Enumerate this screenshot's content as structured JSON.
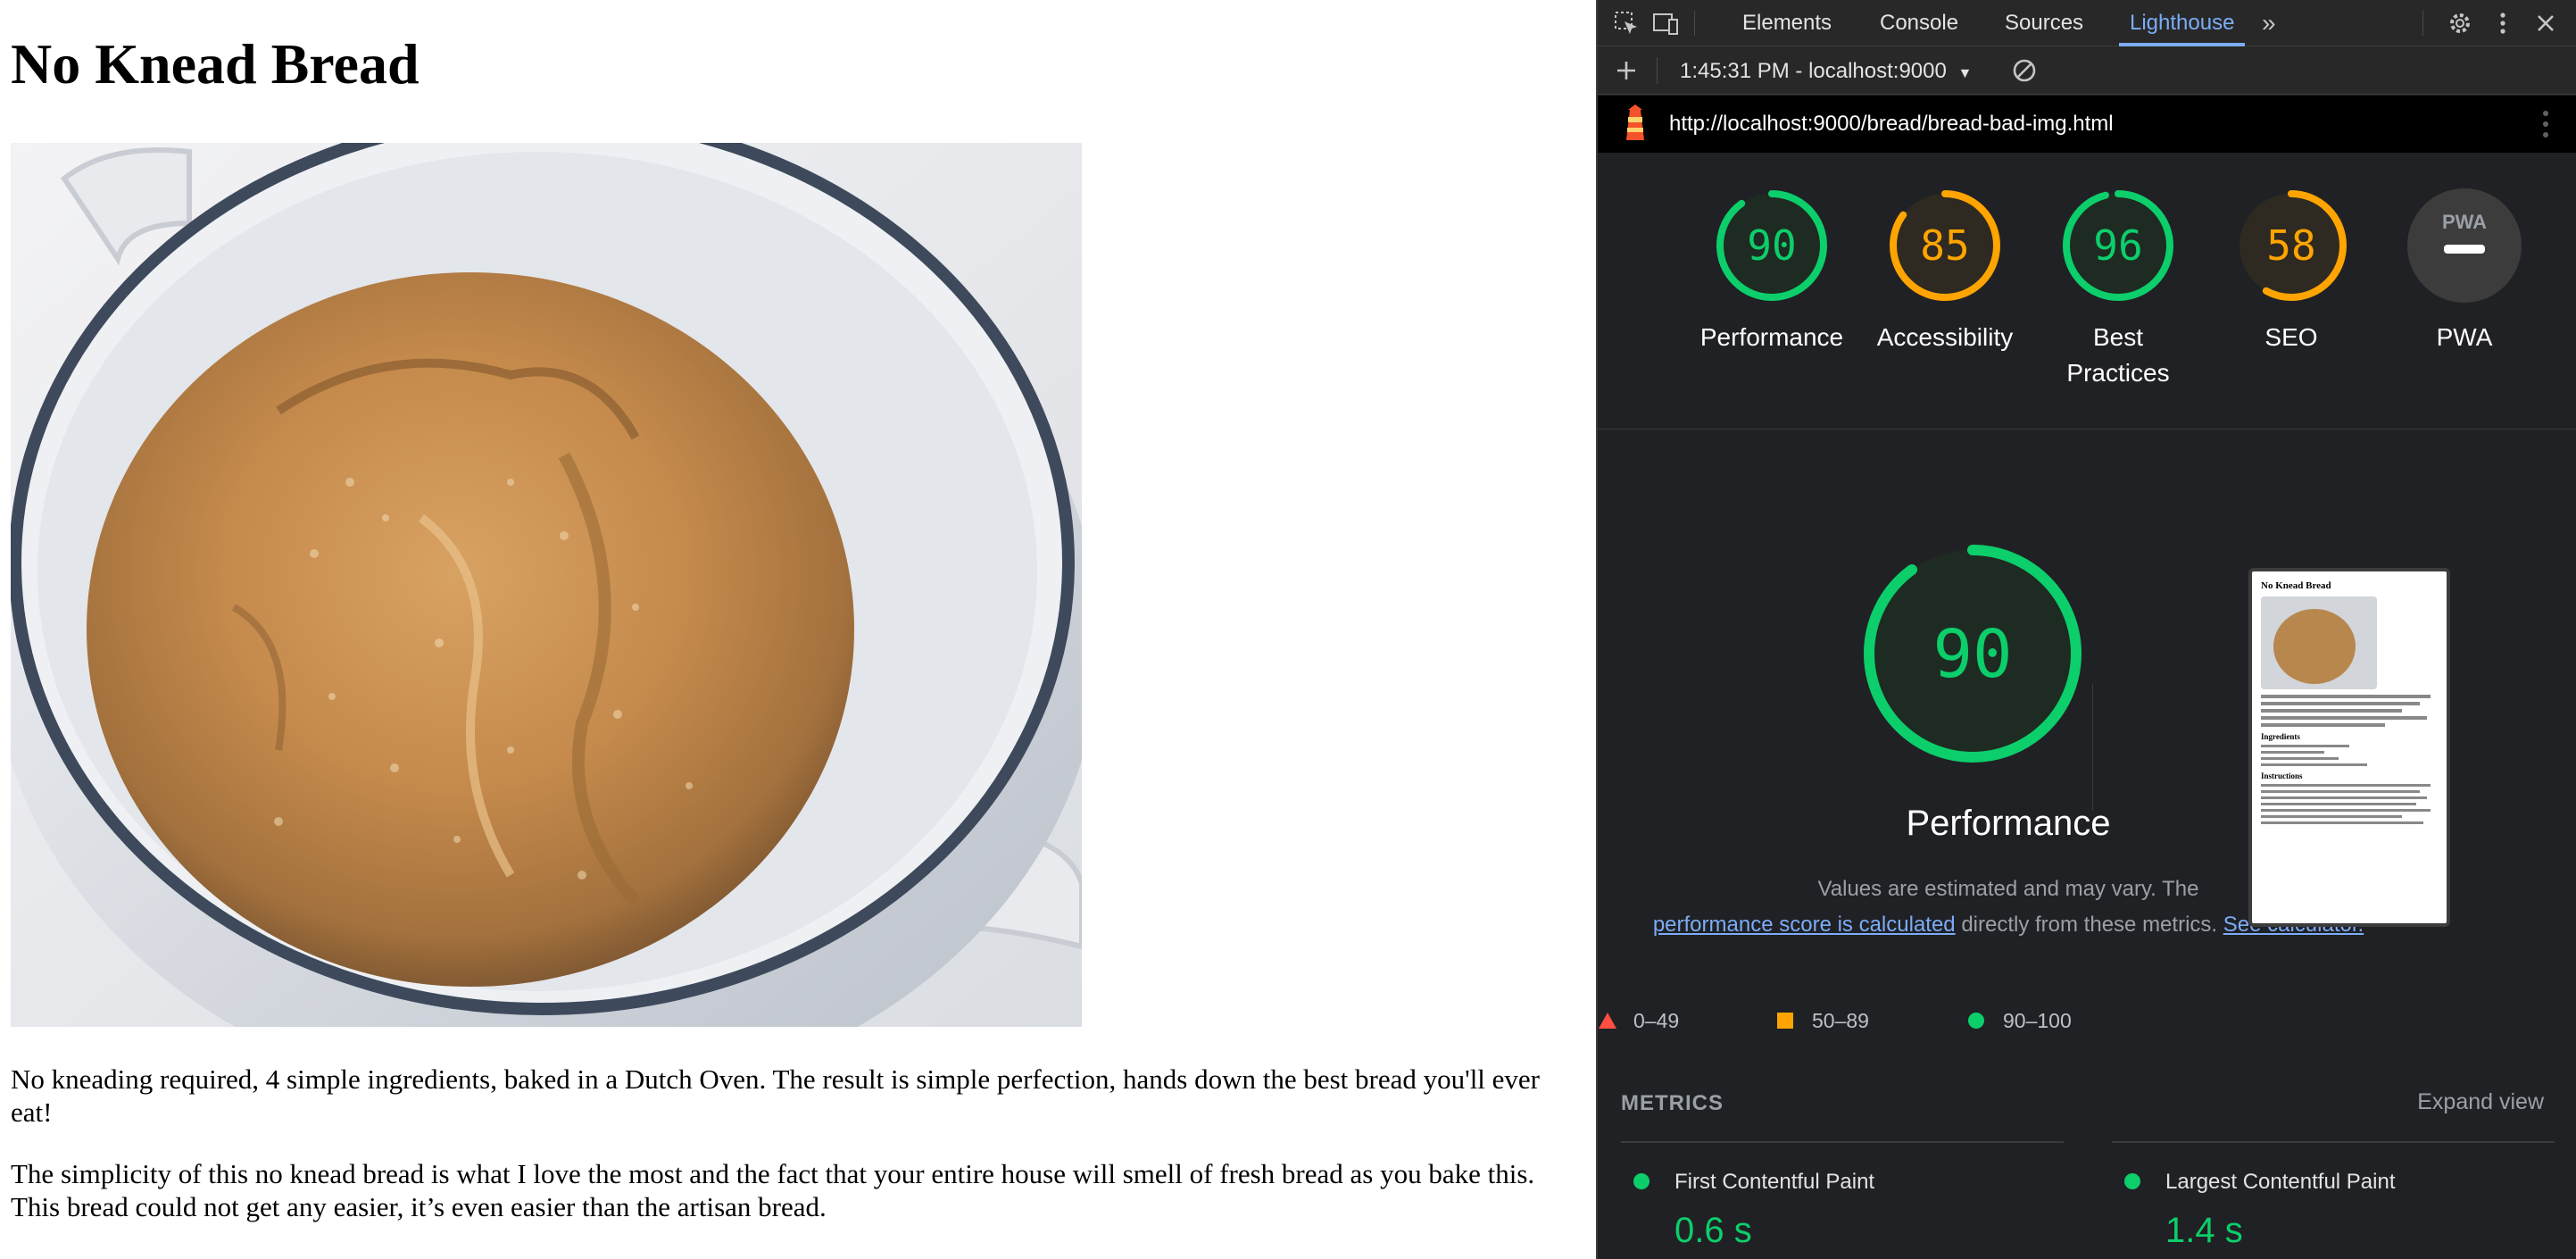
{
  "page": {
    "title": "No Knead Bread",
    "paragraph1": "No kneading required, 4 simple ingredients, baked in a Dutch Oven. The result is simple perfection, hands down the best bread you'll ever eat!",
    "paragraph2": "The simplicity of this no knead bread is what I love the most and the fact that your entire house will smell of fresh bread as you bake this. This bread could not get any easier, it’s even easier than the artisan bread."
  },
  "devtools": {
    "tabs": [
      "Elements",
      "Console",
      "Sources",
      "Lighthouse"
    ],
    "active_tab": "Lighthouse",
    "more_tabs_icon": "chevron-double-right-icon",
    "report_select": "1:45:31 PM - localhost:9000",
    "url": "http://localhost:9000/bread/bread-bad-img.html",
    "gauges": [
      {
        "label": "Performance",
        "score": "90",
        "color": "#0cce6b"
      },
      {
        "label": "Accessibility",
        "score": "85",
        "color": "#ffa400"
      },
      {
        "label": "Best\nPractices",
        "score": "96",
        "color": "#0cce6b"
      },
      {
        "label": "SEO",
        "score": "58",
        "color": "#ffa400"
      },
      {
        "label": "PWA",
        "score": "",
        "color": "#9aa0a6"
      }
    ],
    "pwa_badge": "PWA",
    "performance": {
      "score": "90",
      "title": "Performance",
      "desc_before": "Values are estimated and may vary. The",
      "desc_link": "performance score is calculated",
      "desc_middle": "directly from these metrics.",
      "desc_link2": "See calculator."
    },
    "legend": [
      {
        "label": "0–49",
        "color": "#ff4e42",
        "shape": "triangle"
      },
      {
        "label": "50–89",
        "color": "#ffa400",
        "shape": "square"
      },
      {
        "label": "90–100",
        "color": "#0cce6b",
        "shape": "circle"
      }
    ],
    "metrics_title": "METRICS",
    "expand_view": "Expand view",
    "metrics": [
      {
        "name": "First Contentful Paint",
        "value": "0.6 s"
      },
      {
        "name": "Largest Contentful Paint",
        "value": "1.4 s"
      }
    ],
    "thumbnail": {
      "title": "No Knead Bread",
      "ingredients_heading": "Ingredients",
      "instructions_heading": "Instructions"
    }
  }
}
